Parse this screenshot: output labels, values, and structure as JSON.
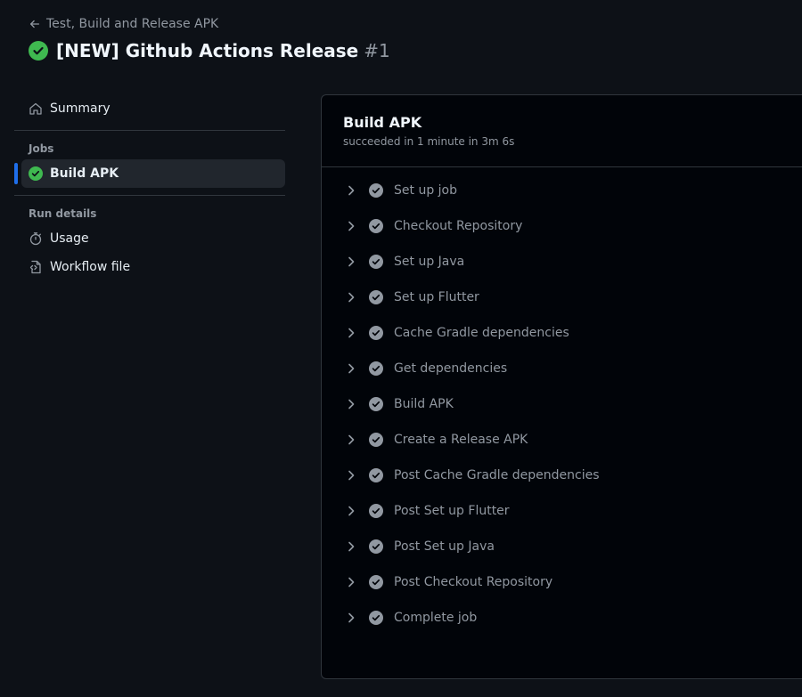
{
  "header": {
    "back_label": "Test, Build and Release APK",
    "title": "[NEW] Github Actions Release",
    "run_number": "#1"
  },
  "sidebar": {
    "summary_label": "Summary",
    "jobs_heading": "Jobs",
    "job_label": "Build APK",
    "run_details_heading": "Run details",
    "usage_label": "Usage",
    "workflow_file_label": "Workflow file"
  },
  "job": {
    "title": "Build APK",
    "status_text": "succeeded in 1 minute in 3m 6s",
    "steps": [
      {
        "label": "Set up job"
      },
      {
        "label": "Checkout Repository"
      },
      {
        "label": "Set up Java"
      },
      {
        "label": "Set up Flutter"
      },
      {
        "label": "Cache Gradle dependencies"
      },
      {
        "label": "Get dependencies"
      },
      {
        "label": "Build APK"
      },
      {
        "label": "Create a Release APK"
      },
      {
        "label": "Post Cache Gradle dependencies"
      },
      {
        "label": "Post Set up Flutter"
      },
      {
        "label": "Post Set up Java"
      },
      {
        "label": "Post Checkout Repository"
      },
      {
        "label": "Complete job"
      }
    ]
  },
  "colors": {
    "background": "#0d1117",
    "success": "#3fb950",
    "accent": "#1f6feb",
    "muted_text": "#9198a1"
  }
}
